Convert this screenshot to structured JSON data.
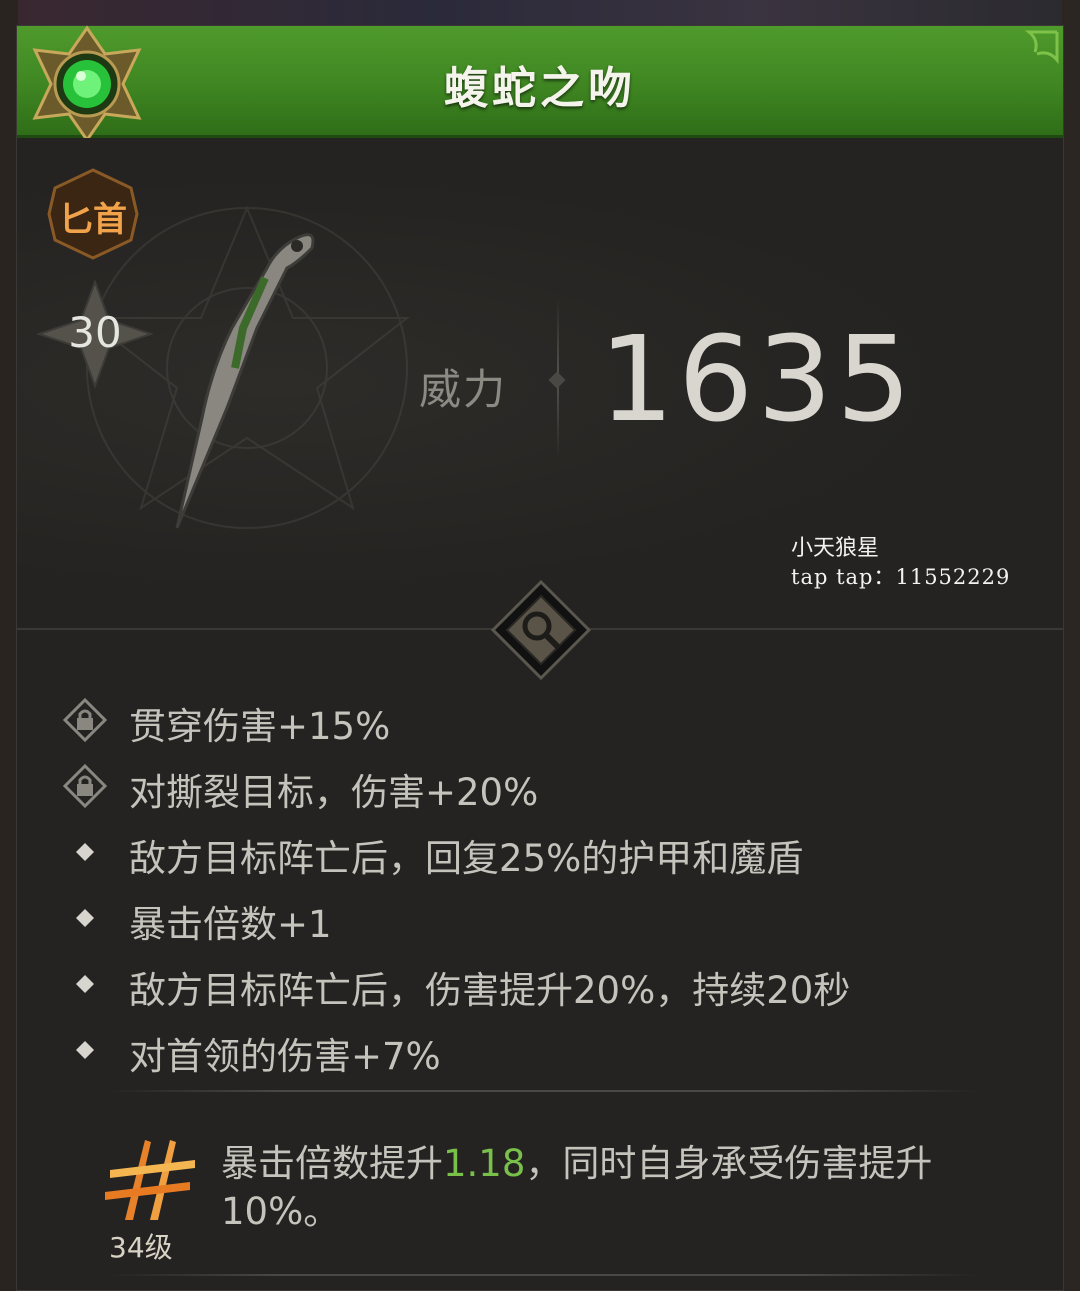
{
  "item": {
    "name": "蝮蛇之吻",
    "type_label": "匕首",
    "level": "30",
    "power_label": "威力",
    "power_value": "1635"
  },
  "watermark": {
    "name": "小天狼星",
    "id": "tap tap：11552229"
  },
  "stats": [
    {
      "icon": "lock-icon",
      "text": "贯穿伤害+15%"
    },
    {
      "icon": "lock-icon",
      "text": "对撕裂目标，伤害+20%"
    },
    {
      "icon": "diamond-bullet-icon",
      "text": "敌方目标阵亡后，回复25%的护甲和魔盾"
    },
    {
      "icon": "diamond-bullet-icon",
      "text": "暴击倍数+1"
    },
    {
      "icon": "diamond-bullet-icon",
      "text": "敌方目标阵亡后，伤害提升20%，持续20秒"
    },
    {
      "icon": "diamond-bullet-icon",
      "text": "对首领的伤害+7%"
    }
  ],
  "awaken": {
    "level_label": "34级",
    "text_before": "暴击倍数提升",
    "highlight": "1.18",
    "text_after": "，同时自身承受伤害提升10%。"
  },
  "colors": {
    "header_green": "#3f8622",
    "type_orange": "#f0a34a",
    "highlight_green": "#78c04a"
  }
}
